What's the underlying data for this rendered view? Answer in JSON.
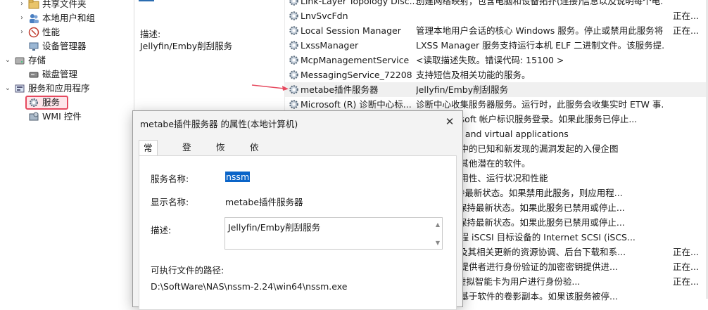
{
  "tree": {
    "items": [
      {
        "label": "共享文件夹",
        "icon": "shared-folder-icon",
        "chevron": "›"
      },
      {
        "label": "本地用户和组",
        "icon": "users-icon",
        "chevron": "›"
      },
      {
        "label": "性能",
        "icon": "performance-icon",
        "chevron": "›"
      },
      {
        "label": "设备管理器",
        "icon": "device-manager-icon",
        "chevron": ""
      },
      {
        "label": "存储",
        "icon": "storage-icon",
        "chevron": "⌄"
      },
      {
        "label": "磁盘管理",
        "icon": "disk-icon",
        "chevron": ""
      },
      {
        "label": "服务和应用程序",
        "icon": "services-apps-icon",
        "chevron": "⌄"
      },
      {
        "label": "服务",
        "icon": "services-gear-icon",
        "chevron": ""
      },
      {
        "label": "WMI 控件",
        "icon": "wmi-icon",
        "chevron": ""
      }
    ]
  },
  "desc_pane": {
    "label": "描述:",
    "text": "Jellyfin/Emby削刮服务"
  },
  "services": [
    {
      "name": "Link-Layer Topology Disc...",
      "desc": "创建网络映射，包含电脑和设备拓扑(连接)信息以及说明每个电...",
      "status": ""
    },
    {
      "name": "LnvSvcFdn",
      "desc": "",
      "status": "正在..."
    },
    {
      "name": "Local Session Manager",
      "desc": "管理本地用户会话的核心 Windows 服务。停止或禁用此服务将...",
      "status": "正在..."
    },
    {
      "name": "LxssManager",
      "desc": "LXSS Manager 服务支持运行本机 ELF 二进制文件。该服务提...",
      "status": ""
    },
    {
      "name": "McpManagementService",
      "desc": "<读取描述失败。错误代码: 15100 >",
      "status": ""
    },
    {
      "name": "MessagingService_72208",
      "desc": "支持短信及相关功能的服务。",
      "status": ""
    },
    {
      "name": "metabe插件服务器",
      "desc": "Jellyfin/Emby削刮服务",
      "status": ""
    },
    {
      "name": "Microsoft (R) 诊断中心标...",
      "desc": "诊断中心收集服务器服务。运行时，此服务会收集实时 ETW 事...",
      "status": ""
    },
    {
      "name": "",
      "desc": "启用 Microsoft 帐户标识服务登录。如果此服务已停止...",
      "status": ""
    },
    {
      "name": "",
      "desc": "pp-V users and virtual applications",
      "status": ""
    },
    {
      "name": "",
      "desc": "时网络协议中的已知和新发现的漏洞发起的入侵企图",
      "status": ""
    },
    {
      "name": "",
      "desc": "恶意软件及其他潜在的软件。",
      "status": ""
    },
    {
      "name": "",
      "desc": "生组件的可用性、运行状况和性能",
      "status": ""
    },
    {
      "name": "",
      "desc": "t Edge 保持最新状态。如果禁用此服务，则应用程...",
      "status": ""
    },
    {
      "name": "",
      "desc": "osoft 软件保持最新状态。如果此服务已禁用或停止...",
      "status": ""
    },
    {
      "name": "",
      "desc": "osoft 软件保持最新状态。如果此服务已禁用或停止...",
      "status": ""
    },
    {
      "name": "",
      "desc": "计算机到远程 iSCSI 目标设备的 Internet SCSI (iSCS...",
      "status": ""
    },
    {
      "name": "",
      "desc": "oft Office 及其相关更新的资源协调、后台下载和系...",
      "status": "正在..."
    },
    {
      "name": "",
      "desc": "关联的标识提供者进行身份验证的加密密钥提供进...",
      "status": "正在..."
    },
    {
      "name": "",
      "desc": "储与 TPM 虚拟智能卡为用户进行身份验...",
      "status": "正在..."
    },
    {
      "name": "",
      "desc": "服务制作的基于软件的卷影副本。如果该服务被停...",
      "status": ""
    }
  ],
  "dialog": {
    "title": "metabe插件服务器 的属性(本地计算机)",
    "close": "✕",
    "tabs": [
      "常规",
      "登录",
      "恢复",
      "依存关系"
    ],
    "service_name_label": "服务名称:",
    "service_name": "nssm",
    "display_name_label": "显示名称:",
    "display_name": "metabe插件服务器",
    "description_label": "描述:",
    "description": "Jellyfin/Emby削刮服务",
    "path_label": "可执行文件的路径:",
    "path": "D:\\SoftWare\\NAS\\nssm-2.24\\win64\\nssm.exe"
  },
  "colors": {
    "highlight_border": "#e64a5f",
    "selection": "#0a64c8",
    "arrow": "#e64a5f"
  }
}
